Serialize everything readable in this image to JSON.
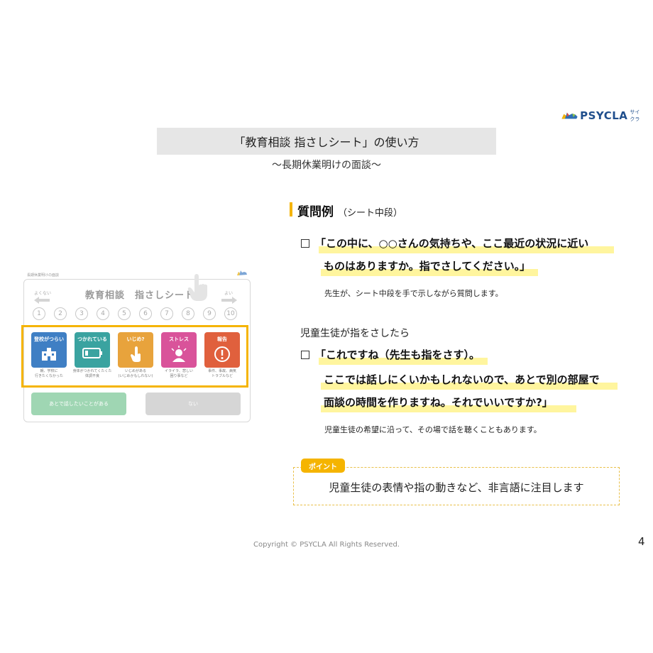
{
  "logo": {
    "text": "PSYCLA",
    "sub": "サイクラ"
  },
  "title": "「教育相談 指さしシート」の使い方",
  "subtitle": "～長期休業明けの面談～",
  "sheet": {
    "small_label": "長期休業明けの面談",
    "title": "教育相談　指さしシート",
    "left_label": "よくない",
    "right_label": "よい",
    "numbers": [
      "1",
      "2",
      "3",
      "4",
      "5",
      "6",
      "7",
      "8",
      "9",
      "10"
    ],
    "cards": [
      {
        "label": "登校がつらい",
        "caption": "朝、学校に\n行きたくなかった",
        "color": "#3f7fc4",
        "icon": "school-icon"
      },
      {
        "label": "つかれている",
        "caption": "身体がつかれてくたくた\n体調不良",
        "color": "#3aa3a0",
        "icon": "battery-icon"
      },
      {
        "label": "いじめ?",
        "caption": "いじめがある\n(いじめかもしれない)",
        "color": "#e8a33c",
        "icon": "stop-hand-icon"
      },
      {
        "label": "ストレス",
        "caption": "イライラ、悲しい\n困り事など",
        "color": "#d9539a",
        "icon": "stress-icon"
      },
      {
        "label": "報告",
        "caption": "事件、事故、病気\nトラブルなど",
        "color": "#e0603d",
        "icon": "alert-icon"
      }
    ],
    "btn_later": "あとで話したいことがある",
    "btn_none": "ない"
  },
  "section": {
    "title": "質問例",
    "sub": "（シート中段）"
  },
  "q1": {
    "line1": "「この中に、○○さんの気持ちや、ここ最近の状況に近い",
    "line2": "ものはありますか。指でさしてください。」",
    "note": "先生が、シート中段を手で示しながら質問します。"
  },
  "mid_text": "児童生徒が指をさしたら",
  "q2": {
    "line1": "「これですね（先生も指をさす）。",
    "line2": "ここでは話しにくいかもしれないので、あとで別の部屋で",
    "line3": "面談の時間を作りますね。それでいいですか?」",
    "note": "児童生徒の希望に沿って、その場で話を聴くこともあります。"
  },
  "point": {
    "tag": "ポイント",
    "text": "児童生徒の表情や指の動きなど、非言語に注目します"
  },
  "copyright": "Copyright © PSYCLA All Rights Reserved.",
  "page_number": "4"
}
